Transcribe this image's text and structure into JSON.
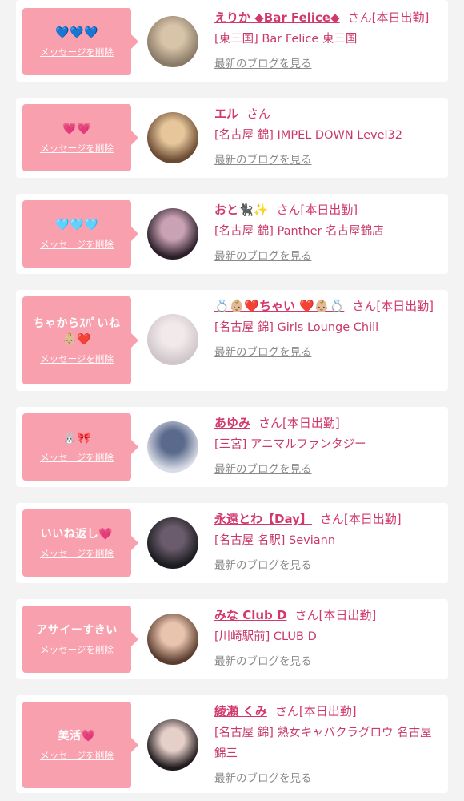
{
  "delete_label": "メッセージを削除",
  "honorific": "さん",
  "blog_label": "最新のブログを見る",
  "items": [
    {
      "message": "💙💙💙",
      "name": "えりか ◆Bar Felice◆",
      "attendance": "[本日出勤]",
      "shop": "[東三国] Bar Felice 東三国",
      "avatar_colors": [
        "#8a7a68",
        "#d8c4a8"
      ]
    },
    {
      "message": "💗💗",
      "name": "エル",
      "attendance": "",
      "shop": "[名古屋 錦] IMPEL DOWN Level32",
      "avatar_colors": [
        "#6a4a32",
        "#e6c69a"
      ]
    },
    {
      "message": "🩵🩵🩵",
      "name": "おと🐈‍⬛✨",
      "attendance": "[本日出勤]",
      "shop": "[名古屋 錦] Panther 名古屋錦店",
      "avatar_colors": [
        "#2a1e28",
        "#c9a2b4"
      ]
    },
    {
      "message": "ちゃからｽﾊﾟいね👶🏼❤️",
      "name": "💍👶🏼❤️ちゃい ❤️👶🏼💍",
      "attendance": "[本日出勤]",
      "shop": "[名古屋 錦] Girls Lounge Chill",
      "avatar_colors": [
        "#cfc6c9",
        "#f1eaea"
      ]
    },
    {
      "message": "🐰🎀",
      "name": "あゆみ",
      "attendance": "[本日出勤]",
      "shop": "[三宮] アニマルファンタジー",
      "avatar_colors": [
        "#d9dce6",
        "#5a6a8c"
      ]
    },
    {
      "message": "いいね返し💗",
      "name": "永遠とわ【Day】",
      "attendance": "[本日出勤]",
      "shop": "[名古屋 名駅] Seviann",
      "avatar_colors": [
        "#1b1b20",
        "#6a5c6c"
      ]
    },
    {
      "message": "アサイーすきい",
      "name": "みな Club D",
      "attendance": "[本日出勤]",
      "shop": "[川崎駅前] CLUB D",
      "avatar_colors": [
        "#5a3c2e",
        "#e8c3ae"
      ]
    },
    {
      "message": "美活💗",
      "name": "綾瀬 くみ",
      "attendance": "[本日出勤]",
      "shop": "[名古屋 錦] 熟女キャバクラグロウ 名古屋錦三",
      "avatar_colors": [
        "#201a1e",
        "#e6cfc8"
      ]
    }
  ]
}
